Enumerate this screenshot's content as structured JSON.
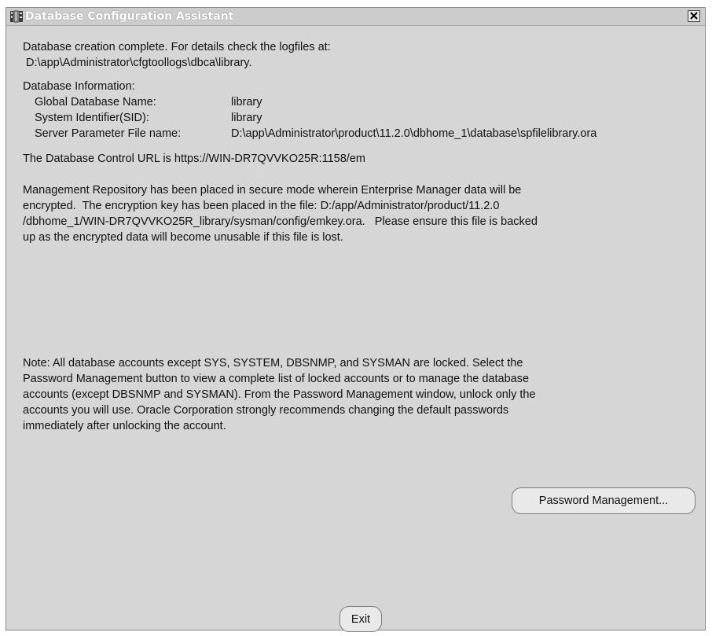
{
  "window": {
    "title": "Database Configuration Assistant",
    "close_icon": "close-icon",
    "app_icon": "database-icon"
  },
  "messages": {
    "completion_line1": "Database creation complete. For details check the logfiles at:",
    "completion_line2": " D:\\app\\Administrator\\cfgtoollogs\\dbca\\library.",
    "db_info_heading": "Database Information:",
    "db_info": [
      {
        "label": "Global Database Name:",
        "value": "library"
      },
      {
        "label": "System Identifier(SID):",
        "value": "library"
      },
      {
        "label": "Server Parameter File name:",
        "value": "D:\\app\\Administrator\\product\\11.2.0\\dbhome_1\\database\\spfilelibrary.ora"
      }
    ],
    "control_url": "The Database Control URL is https://WIN-DR7QVVKO25R:1158/em",
    "repository_lines": [
      "Management Repository has been placed in secure mode wherein Enterprise Manager data will be",
      "encrypted.  The encryption key has been placed in the file: D:/app/Administrator/product/11.2.0",
      "/dbhome_1/WIN-DR7QVVKO25R_library/sysman/config/emkey.ora.   Please ensure this file is backed",
      "up as the encrypted data will become unusable if this file is lost."
    ],
    "note_lines": [
      "Note: All database accounts except SYS, SYSTEM, DBSNMP, and SYSMAN are locked. Select the",
      "Password Management button to view a complete list of locked accounts or to manage the database",
      "accounts (except DBSNMP and SYSMAN). From the Password Management window, unlock only the",
      "accounts you will use. Oracle Corporation strongly recommends changing the default passwords",
      "immediately after unlocking the account."
    ]
  },
  "buttons": {
    "password_management": "Password Management...",
    "exit": "Exit"
  }
}
